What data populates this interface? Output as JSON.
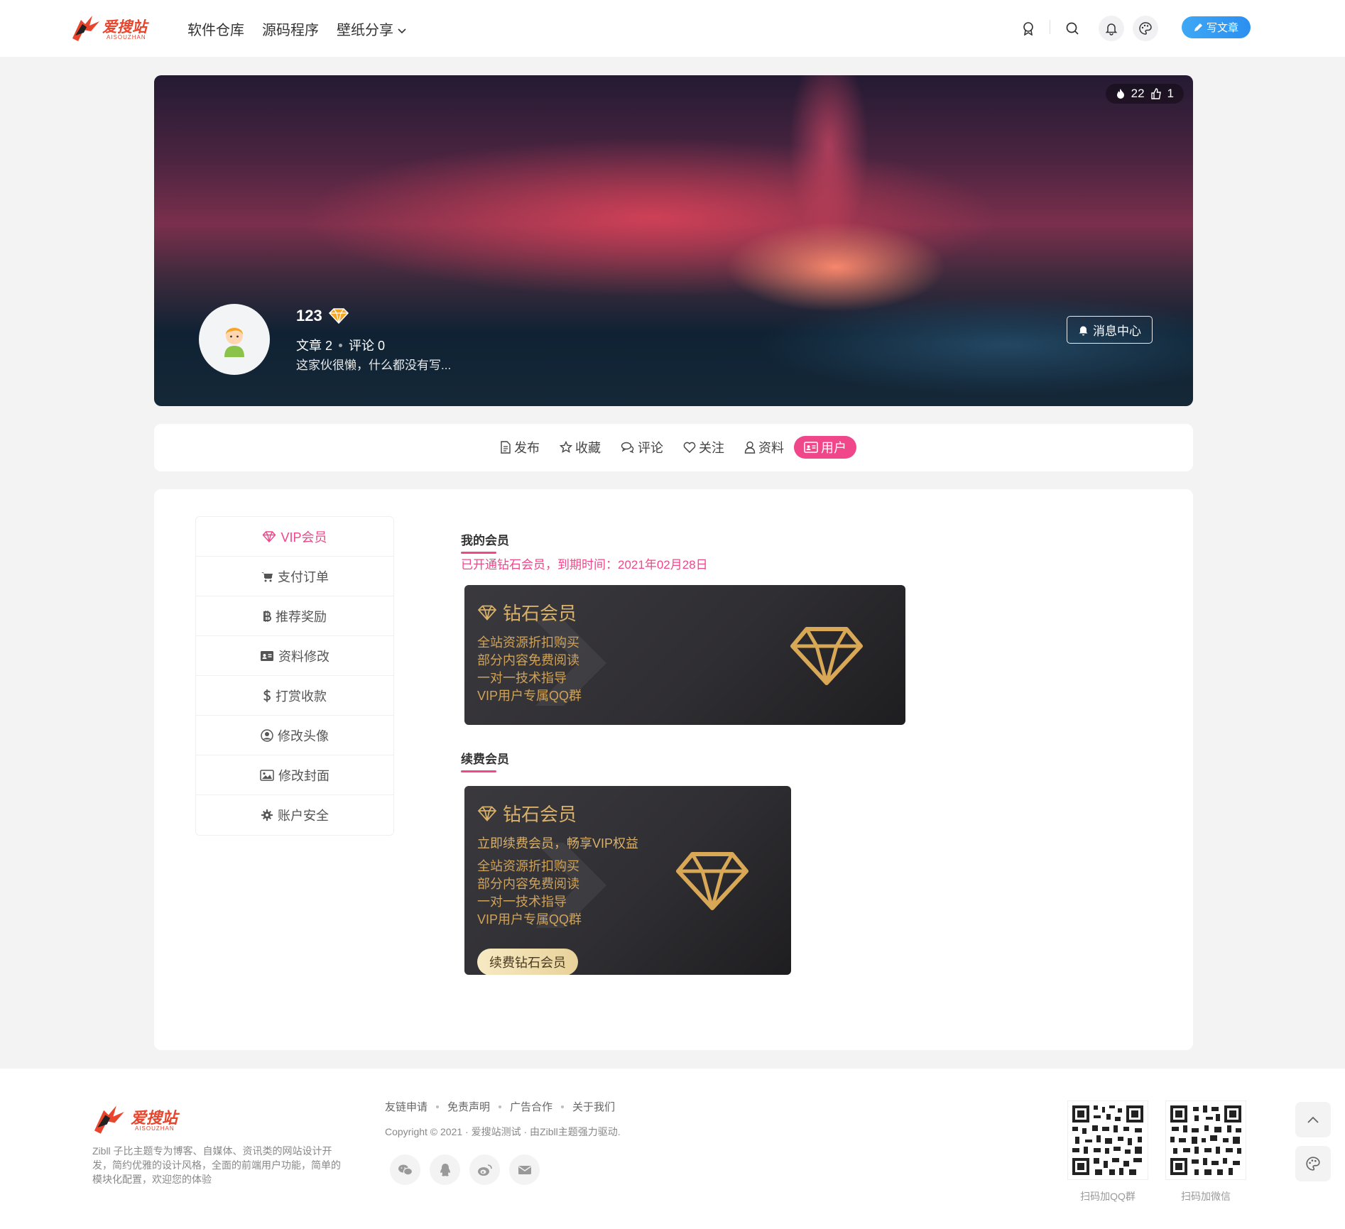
{
  "header": {
    "logo_text": "爱搜站",
    "logo_sub": "AISOUZHAN",
    "nav": [
      "软件仓库",
      "源码程序",
      "壁纸分享"
    ],
    "write_label": "写文章"
  },
  "banner": {
    "hot_count": "22",
    "like_count": "1",
    "username": "123",
    "articles_label": "文章",
    "articles_count": "2",
    "comments_label": "评论",
    "comments_count": "0",
    "bio": "这家伙很懒，什么都没有写...",
    "message_center": "消息中心"
  },
  "tabs": [
    {
      "label": "发布",
      "icon": "document-icon"
    },
    {
      "label": "收藏",
      "icon": "star-icon"
    },
    {
      "label": "评论",
      "icon": "comments-icon"
    },
    {
      "label": "关注",
      "icon": "heart-icon"
    },
    {
      "label": "资料",
      "icon": "user-icon"
    },
    {
      "label": "用户",
      "icon": "id-card-icon",
      "active": true
    }
  ],
  "menu": [
    {
      "label": "VIP会员",
      "icon": "diamond-icon",
      "active": true
    },
    {
      "label": "支付订单",
      "icon": "cart-icon"
    },
    {
      "label": "推荐奖励",
      "icon": "bitcoin-icon"
    },
    {
      "label": "资料修改",
      "icon": "id-card-icon"
    },
    {
      "label": "打赏收款",
      "icon": "dollar-icon"
    },
    {
      "label": "修改头像",
      "icon": "user-circle-icon"
    },
    {
      "label": "修改封面",
      "icon": "image-icon"
    },
    {
      "label": "账户安全",
      "icon": "gear-icon"
    }
  ],
  "vip": {
    "my_title": "我的会员",
    "status": "已开通钻石会员，到期时间：2021年02月28日",
    "card_title": "钻石会员",
    "benefits": [
      "全站资源折扣购买",
      "部分内容免费阅读",
      "一对一技术指导",
      "VIP用户专属QQ群"
    ],
    "renew_title": "续费会员",
    "renew_sub": "立即续费会员，畅享VIP权益",
    "renew_button": "续费钻石会员"
  },
  "footer": {
    "logo_text": "爱搜站",
    "logo_sub": "AISOUZHAN",
    "desc": "Zibll 子比主题专为博客、自媒体、资讯类的网站设计开发，简约优雅的设计风格，全面的前端用户功能，简单的模块化配置，欢迎您的体验",
    "links": [
      "友链申请",
      "免责声明",
      "广告合作",
      "关于我们"
    ],
    "copyright": "Copyright © 2021 · 爱搜站测试 · 由Zibll主题强力驱动.",
    "qr_qq": "扫码加QQ群",
    "qr_wechat": "扫码加微信"
  },
  "colors": {
    "accent": "#f0468a",
    "gold": "#d9b06a",
    "blue": "#3ea8f5"
  }
}
